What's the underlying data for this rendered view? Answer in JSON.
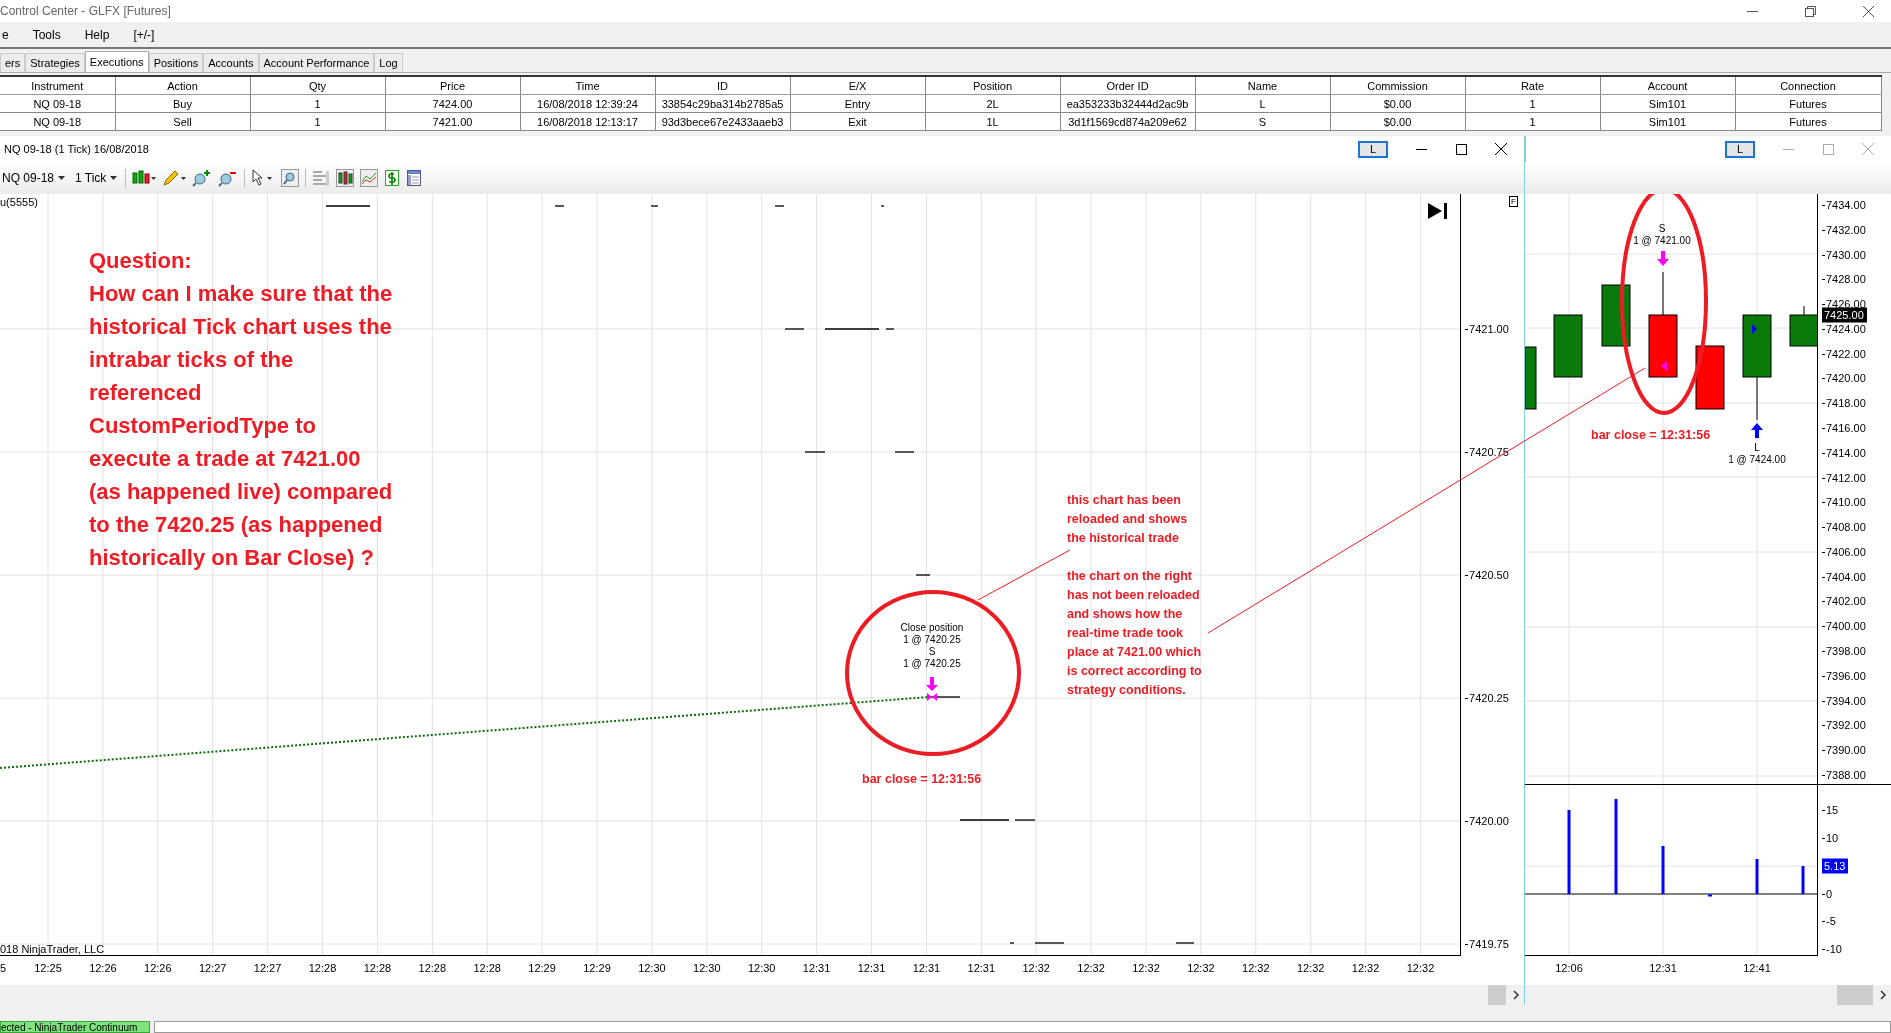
{
  "window": {
    "title": "Control Center - GLFX [Futures]"
  },
  "menu": [
    {
      "label": "e"
    },
    {
      "label": "Tools"
    },
    {
      "label": "Help"
    },
    {
      "label": "[+/-]"
    }
  ],
  "tabs": [
    {
      "label": "ers",
      "selected": false
    },
    {
      "label": "Strategies",
      "selected": false
    },
    {
      "label": "Executions",
      "selected": true
    },
    {
      "label": "Positions",
      "selected": false
    },
    {
      "label": "Accounts",
      "selected": false
    },
    {
      "label": "Account Performance",
      "selected": false
    },
    {
      "label": "Log",
      "selected": false
    }
  ],
  "executions": {
    "columns": [
      "Instrument",
      "Action",
      "Qty",
      "Price",
      "Time",
      "ID",
      "E/X",
      "Position",
      "Order ID",
      "Name",
      "Commission",
      "Rate",
      "Account",
      "Connection"
    ],
    "rows": [
      [
        "NQ 09-18",
        "Buy",
        "1",
        "7424.00",
        "16/08/2018 12:39:24",
        "33854c29ba314b2785a5",
        "Entry",
        "2L",
        "ea353233b32444d2ac9b",
        "L",
        "$0.00",
        "1",
        "Sim101",
        "Futures"
      ],
      [
        "NQ 09-18",
        "Sell",
        "1",
        "7421.00",
        "16/08/2018 12:13:17",
        "93d3bece67e2433aaeb3",
        "Exit",
        "1L",
        "3d1f1569cd874a209e62",
        "S",
        "$0.00",
        "1",
        "Sim101",
        "Futures"
      ]
    ]
  },
  "chart": {
    "title": "NQ 09-18 (1 Tick)  16/08/2018",
    "link_button": "L",
    "instrument": "NQ 09-18",
    "interval": "1 Tick",
    "indicator": "u(5555)",
    "copyright": "018 NinjaTrader, LLC",
    "data_box": "F",
    "y_labels": [
      "7421.00",
      "7420.75",
      "7420.50",
      "7420.25",
      "7420.00",
      "7419.75"
    ],
    "x_labels": [
      "5",
      "12:25",
      "12:26",
      "12:26",
      "12:27",
      "12:27",
      "12:28",
      "12:28",
      "12:28",
      "12:28",
      "12:29",
      "12:29",
      "12:30",
      "12:30",
      "12:30",
      "12:31",
      "12:31",
      "12:31",
      "12:31",
      "12:32",
      "12:32",
      "12:32",
      "12:32",
      "12:32",
      "12:32",
      "12:32",
      "12:32"
    ],
    "execution_labels": [
      "Close position",
      "1 @ 7420.25",
      "S",
      "1 @ 7420.25"
    ],
    "bar_close": "bar close = 12:31:56",
    "question": [
      "Question:",
      "How can I make sure that the",
      "historical Tick chart uses the",
      "intrabar ticks of the",
      "referenced",
      "CustomPeriodType to",
      "execute a trade at 7421.00",
      "(as happened live) compared",
      "to the 7420.25 (as happened",
      "historically on Bar Close) ?"
    ],
    "notes": [
      [
        "this chart has been",
        "reloaded and shows",
        "the historical trade"
      ],
      [
        "the chart on the right",
        "has not been reloaded",
        "and shows how the",
        "real-time trade took",
        "place at 7421.00 which",
        "is correct according to",
        "strategy conditions."
      ]
    ]
  },
  "side_chart": {
    "link_button": "L",
    "y_labels": [
      "7434.00",
      "7432.00",
      "7430.00",
      "7428.00",
      "7426.00",
      "7424.00",
      "7422.00",
      "7420.00",
      "7418.00",
      "7416.00",
      "7414.00",
      "7412.00",
      "7410.00",
      "7408.00",
      "7406.00",
      "7404.00",
      "7402.00",
      "7400.00",
      "7398.00",
      "7396.00",
      "7394.00",
      "7392.00",
      "7390.00",
      "7388.00"
    ],
    "price_marker": "7425.00",
    "sell_labels": [
      "S",
      "1 @ 7421.00"
    ],
    "buy_labels": [
      "L",
      "1 @ 7424.00"
    ],
    "bar_close": "bar close = 12:31:56",
    "volume_labels": [
      "15",
      "10",
      "0",
      "-5",
      "-10"
    ],
    "volume_marker": "5.13",
    "x_labels": [
      "12:06",
      "12:31",
      "12:41"
    ]
  },
  "status_bar": {
    "connection": "ected - NinjaTrader Continuum"
  }
}
